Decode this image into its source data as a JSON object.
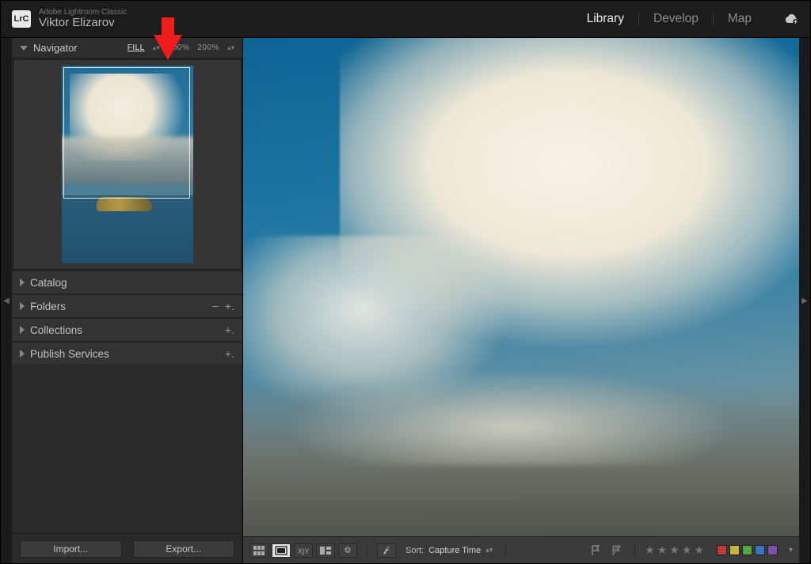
{
  "header": {
    "logo_text": "LrC",
    "product": "Adobe Lightroom Classic",
    "user": "Viktor Elizarov",
    "modules": [
      {
        "label": "Library",
        "active": true
      },
      {
        "label": "Develop",
        "active": false
      },
      {
        "label": "Map",
        "active": false
      }
    ]
  },
  "navigator": {
    "title": "Navigator",
    "zoom": {
      "fill": "FILL",
      "pct100": "100%",
      "pct200": "200%",
      "selected": "FILL"
    }
  },
  "side_sections": {
    "catalog": "Catalog",
    "folders": "Folders",
    "collections": "Collections",
    "publish_services": "Publish Services"
  },
  "buttons": {
    "import": "Import...",
    "export": "Export..."
  },
  "toolbar": {
    "sort_label": "Sort:",
    "sort_value": "Capture Time",
    "color_labels": [
      "#c13a3a",
      "#c7b43a",
      "#55a63e",
      "#3a74c1",
      "#7b4fb0"
    ]
  }
}
